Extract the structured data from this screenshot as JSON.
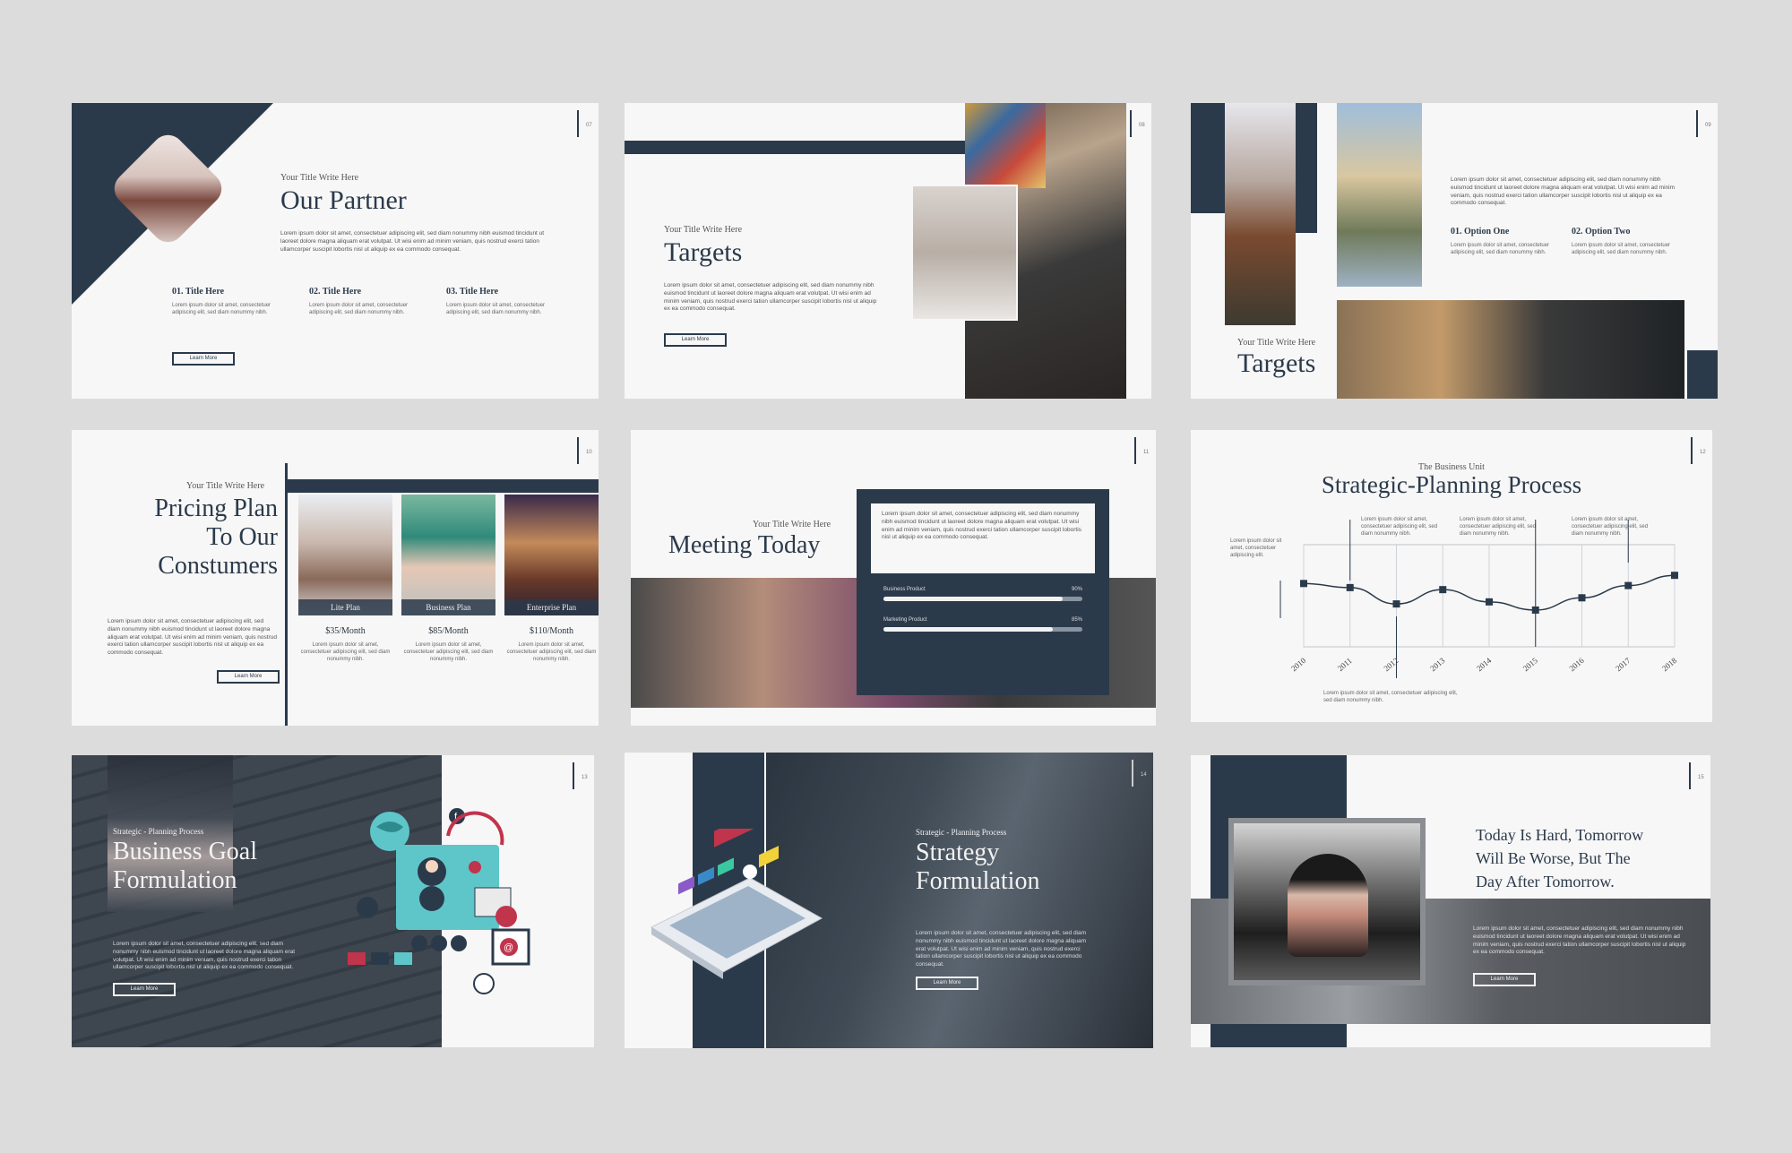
{
  "lorem_long": "Lorem ipsum dolor sit amet, consectetuer adipiscing elit, sed diam nonummy nibh euismod tincidunt ut laoreet dolore magna aliquam erat volutpat. Ut wisi enim ad minim veniam, quis nostrud exerci tation ullamcorper suscipit lobortis nisl ut aliquip ex ea commodo consequat.",
  "lorem_short": "Lorem ipsum dolor sit amet, consectetuer adipiscing elit, sed diam nonummy nibh.",
  "learn_more": "Learn More",
  "title_write_here": "Your Title Write Here",
  "s1": {
    "num": "07",
    "title": "Our Partner",
    "items": [
      {
        "title": "01. Title Here"
      },
      {
        "title": "02. Title Here"
      },
      {
        "title": "03. Title Here"
      }
    ]
  },
  "s2": {
    "num": "08",
    "title": "Targets"
  },
  "s3": {
    "num": "09",
    "title": "Targets",
    "opt1": "01. Option One",
    "opt2": "02. Option Two"
  },
  "s4": {
    "num": "10",
    "title_l1": "Pricing Plan",
    "title_l2": "To Our",
    "title_l3": "Constumers",
    "plans": [
      {
        "name": "Lite Plan",
        "price": "$35/Month"
      },
      {
        "name": "Business Plan",
        "price": "$85/Month"
      },
      {
        "name": "Enterprise Plan",
        "price": "$110/Month"
      }
    ]
  },
  "s5": {
    "num": "11",
    "title": "Meeting Today",
    "bars": [
      {
        "label": "Business Product",
        "pct_text": "90%",
        "value": 0.9
      },
      {
        "label": "Marketing Product",
        "pct_text": "85%",
        "value": 0.85
      }
    ]
  },
  "s6": {
    "num": "12",
    "eyebrow": "The Business Unit",
    "title": "Strategic-Planning Process"
  },
  "chart_data": {
    "type": "line",
    "title": "Strategic-Planning Process",
    "x": [
      "2010",
      "2011",
      "2012",
      "2013",
      "2014",
      "2015",
      "2016",
      "2017",
      "2018"
    ],
    "series": [
      {
        "values": [
          62,
          58,
          42,
          56,
          44,
          36,
          48,
          60,
          70
        ]
      }
    ],
    "ylim": [
      0,
      100
    ],
    "grid": true,
    "annotations": [
      "Lorem ipsum dolor sit amet, consectetuer adipiscing elit.",
      "Lorem ipsum dolor sit amet, consectetuer adipiscing elit, sed diam nonummy nibh.",
      "Lorem ipsum dolor sit amet, consectetuer adipiscing elit, sed diam nonummy nibh.",
      "Lorem ipsum dolor sit amet, consectetuer adipiscing elit, sed diam nonummy nibh.",
      "Lorem ipsum dolor sit amet, consectetuer adipiscing elit, sed diam nonummy nibh."
    ]
  },
  "s7": {
    "num": "13",
    "eyebrow": "Strategic - Planning Process",
    "title_l1": "Business Goal",
    "title_l2": "Formulation"
  },
  "s8": {
    "num": "14",
    "eyebrow": "Strategic - Planning Process",
    "title_l1": "Strategy",
    "title_l2": "Formulation"
  },
  "s9": {
    "num": "15",
    "quote_l1": "Today Is Hard, Tomorrow",
    "quote_l2": "Will Be Worse, But The",
    "quote_l3": "Day After Tomorrow."
  },
  "colors": {
    "navy": "#2b3a4b",
    "background": "#dcdcdc",
    "slide": "#f7f7f7",
    "accent_teal": "#5ec6c9",
    "accent_red": "#c0344c"
  }
}
